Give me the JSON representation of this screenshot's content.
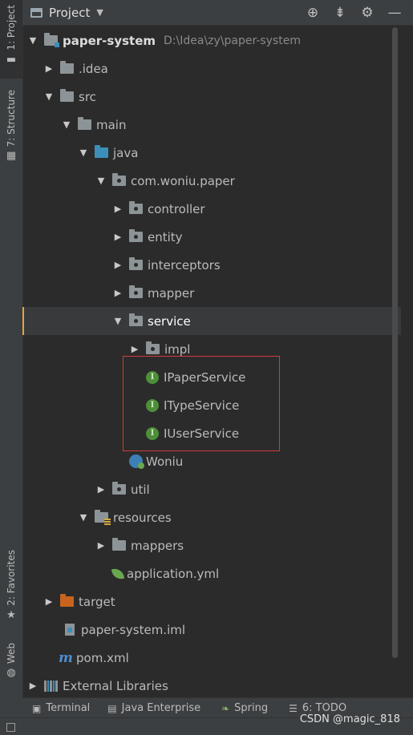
{
  "left_stripe": {
    "tabs": [
      {
        "number": "1",
        "label": "1: Project",
        "icon": "folder-icon",
        "active": true
      },
      {
        "number": "7",
        "label": "7: Structure",
        "icon": "structure-icon",
        "active": false
      },
      {
        "number": "2",
        "label": "2: Favorites",
        "icon": "star-icon",
        "active": false
      },
      {
        "number": "",
        "label": "Web",
        "icon": "globe-icon",
        "active": false
      }
    ]
  },
  "header": {
    "title": "Project",
    "tools": [
      "locate-icon",
      "collapse-all-icon",
      "settings-gear-icon",
      "minimize-icon"
    ]
  },
  "tree": [
    {
      "label": "paper-system",
      "path": "D:\\Idea\\zy\\paper-system",
      "expanded": true,
      "icon": "module-folder-icon"
    },
    {
      "label": ".idea",
      "expanded": false,
      "icon": "folder-icon"
    },
    {
      "label": "src",
      "expanded": true,
      "icon": "folder-icon"
    },
    {
      "label": "main",
      "expanded": true,
      "icon": "folder-icon"
    },
    {
      "label": "java",
      "expanded": true,
      "icon": "source-root-icon"
    },
    {
      "label": "com.woniu.paper",
      "expanded": true,
      "icon": "package-icon"
    },
    {
      "label": "controller",
      "expanded": false,
      "icon": "package-icon"
    },
    {
      "label": "entity",
      "expanded": false,
      "icon": "package-icon"
    },
    {
      "label": "interceptors",
      "expanded": false,
      "icon": "package-icon"
    },
    {
      "label": "mapper",
      "expanded": false,
      "icon": "package-icon"
    },
    {
      "label": "service",
      "expanded": true,
      "icon": "package-icon",
      "selected": true
    },
    {
      "label": "impl",
      "expanded": false,
      "icon": "package-icon"
    },
    {
      "label": "IPaperService",
      "icon": "interface-icon",
      "icon_letter": "I"
    },
    {
      "label": "ITypeService",
      "icon": "interface-icon",
      "icon_letter": "I"
    },
    {
      "label": "IUserService",
      "icon": "interface-icon",
      "icon_letter": "I"
    },
    {
      "label": "Woniu",
      "icon": "spring-boot-class-icon"
    },
    {
      "label": "util",
      "expanded": false,
      "icon": "package-icon"
    },
    {
      "label": "resources",
      "expanded": true,
      "icon": "resources-root-icon"
    },
    {
      "label": "mappers",
      "expanded": false,
      "icon": "folder-icon"
    },
    {
      "label": "application.yml",
      "icon": "spring-yml-icon"
    },
    {
      "label": "target",
      "expanded": false,
      "icon": "excluded-folder-icon"
    },
    {
      "label": "paper-system.iml",
      "icon": "iml-file-icon"
    },
    {
      "label": "pom.xml",
      "icon": "maven-icon",
      "icon_letter": "m"
    },
    {
      "label": "External Libraries",
      "expanded": false,
      "icon": "libraries-icon"
    }
  ],
  "bottom_tools": [
    {
      "label": "Terminal",
      "icon": "terminal-icon"
    },
    {
      "label": "Java Enterprise",
      "icon": "java-enterprise-icon"
    },
    {
      "label": "Spring",
      "icon": "spring-leaf-icon"
    },
    {
      "label": "6: TODO",
      "icon": "todo-list-icon"
    }
  ],
  "watermark": "CSDN @magic_818",
  "colors": {
    "background": "#2b2b2b",
    "panel": "#3c3f41",
    "selection_marker": "#e8a33d",
    "highlight_box": "#d23b3b",
    "interface_icon": "#4e8f3a",
    "source_folder": "#3d8fba",
    "excluded_folder": "#c8631d"
  }
}
